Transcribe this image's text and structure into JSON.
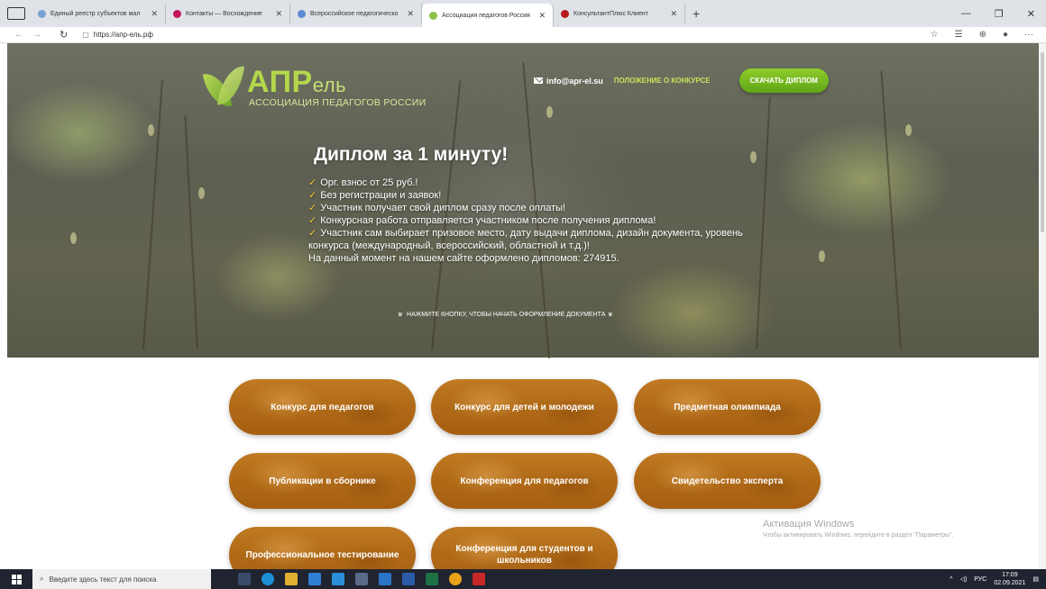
{
  "browser": {
    "tabs": [
      {
        "label": "Единый реестр субъектов мал",
        "color": "#7aa0d8",
        "active": false
      },
      {
        "label": "Контакты — Восхождение",
        "color": "#c2185b",
        "active": false
      },
      {
        "label": "Всероссийское педагогическо",
        "color": "#5b8ad1",
        "active": false
      },
      {
        "label": "Ассоциация педагогов Россия",
        "color": "#8bc34a",
        "active": true
      },
      {
        "label": "КонсультантПлюс Клиент",
        "color": "#b71c1c",
        "active": false
      }
    ],
    "new_tab": "+",
    "url": "https://апр-ель.рф"
  },
  "site": {
    "logo": {
      "brand_main": "АПР",
      "brand_tail": "ель",
      "tagline": "АССОЦИАЦИЯ ПЕДАГОГОВ РОССИИ"
    },
    "email": "info@apr-el.su",
    "rules_link": "ПОЛОЖЕНИЕ О КОНКУРСЕ",
    "download_button": "СКАЧАТЬ ДИПЛОМ",
    "headline": "Диплом за 1 минуту!",
    "bullets": [
      "Орг. взнос от 25 руб.!",
      "Без регистрации и заявок!",
      "Участник получает свой диплом сразу после оплаты!",
      "Конкурсная работа отправляется участником после получения диплома!",
      "Участник сам выбирает призовое место, дату выдачи диплома, дизайн документа, уровень конкурса (международный, всероссийский, областной и т.д.)!"
    ],
    "counter_text": "На данный момент на нашем сайте оформлено дипломов: 274915.",
    "prompt": "НАЖМИТЕ КНОПКУ, ЧТОБЫ НАЧАТЬ ОФОРМЛЕНИЕ ДОКУМЕНТА",
    "buttons": [
      "Конкурс для педагогов",
      "Конкурс для детей и молодежи",
      "Предметная олимпиада",
      "Публикации в сборнике",
      "Конференция для педагогов",
      "Свидетельство эксперта",
      "Профессиональное тестирование",
      "Конференция для студентов и школьников"
    ]
  },
  "activation": {
    "title": "Активация Windows",
    "subtitle": "Чтобы активировать Windows, перейдите в раздел \"Параметры\"."
  },
  "taskbar": {
    "search_placeholder": "Введите здесь текст для поиска",
    "lang": "РУС",
    "time": "17:09",
    "date": "02.09.2021"
  }
}
